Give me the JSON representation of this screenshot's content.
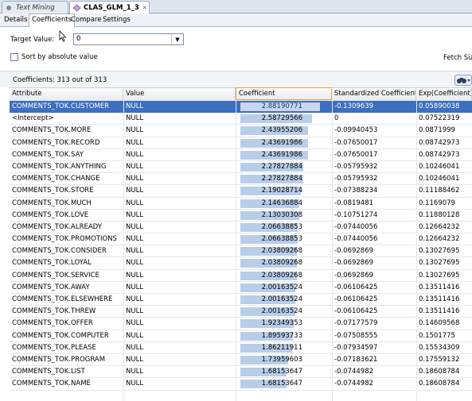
{
  "doc_tabs": [
    {
      "label": "Text Mining",
      "icon": "dot-icon"
    },
    {
      "label": "CLAS_GLM_1_3",
      "icon": "model-icon"
    }
  ],
  "sub_tabs": [
    "Details",
    "Coefficients",
    "Compare",
    "Settings"
  ],
  "target": {
    "label": "Target Value:",
    "value": "0"
  },
  "sort_checkbox": {
    "label": "Sort by absolute value",
    "checked": false
  },
  "fetch_label": "Fetch Siz",
  "coefficients_count": "Coefficients: 313 out of 313",
  "colors": {
    "selected_row": "#3c6fbf",
    "coef_bar": "#b8cde8",
    "sorted_header_border": "#e8a33a"
  },
  "columns": [
    "Attribute",
    "Value",
    "Coefficient",
    "Standardized Coefficient",
    "Exp(Coefficient)"
  ],
  "rows": [
    {
      "attr": "COMMENTS_TOK.CUSTOMER",
      "value": "NULL",
      "coef": "2.88190771",
      "coef_num": 2.88190771,
      "std": "-0.1309639",
      "exp": "0.05890038"
    },
    {
      "attr": "<Intercept>",
      "value": "NULL",
      "coef": "2.58729566",
      "coef_num": 2.58729566,
      "std": "0",
      "exp": "0.07522319"
    },
    {
      "attr": "COMMENTS_TOK.MORE",
      "value": "NULL",
      "coef": "2.43955206",
      "coef_num": 2.43955206,
      "std": "-0.09940453",
      "exp": "0.0871999"
    },
    {
      "attr": "COMMENTS_TOK.RECORD",
      "value": "NULL",
      "coef": "2.43691986",
      "coef_num": 2.43691986,
      "std": "-0.07650017",
      "exp": "0.08742973"
    },
    {
      "attr": "COMMENTS_TOK.SAY",
      "value": "NULL",
      "coef": "2.43691986",
      "coef_num": 2.43691986,
      "std": "-0.07650017",
      "exp": "0.08742973"
    },
    {
      "attr": "COMMENTS_TOK.ANYTHING",
      "value": "NULL",
      "coef": "2.27827884",
      "coef_num": 2.27827884,
      "std": "-0.05795932",
      "exp": "0.10246041"
    },
    {
      "attr": "COMMENTS_TOK.CHANGE",
      "value": "NULL",
      "coef": "2.27827884",
      "coef_num": 2.27827884,
      "std": "-0.05795932",
      "exp": "0.10246041"
    },
    {
      "attr": "COMMENTS_TOK.STORE",
      "value": "NULL",
      "coef": "2.19028714",
      "coef_num": 2.19028714,
      "std": "-0.07388234",
      "exp": "0.11188462"
    },
    {
      "attr": "COMMENTS_TOK.MUCH",
      "value": "NULL",
      "coef": "2.14636884",
      "coef_num": 2.14636884,
      "std": "-0.0819481",
      "exp": "0.1169079"
    },
    {
      "attr": "COMMENTS_TOK.LOVE",
      "value": "NULL",
      "coef": "2.13030308",
      "coef_num": 2.13030308,
      "std": "-0.10751274",
      "exp": "0.11880128"
    },
    {
      "attr": "COMMENTS_TOK.ALREADY",
      "value": "NULL",
      "coef": "2.06638853",
      "coef_num": 2.06638853,
      "std": "-0.07440056",
      "exp": "0.12664232"
    },
    {
      "attr": "COMMENTS_TOK.PROMOTIONS",
      "value": "NULL",
      "coef": "2.06638853",
      "coef_num": 2.06638853,
      "std": "-0.07440056",
      "exp": "0.12664232"
    },
    {
      "attr": "COMMENTS_TOK.CONSIDER",
      "value": "NULL",
      "coef": "2.03809268",
      "coef_num": 2.03809268,
      "std": "-0.0692869",
      "exp": "0.13027695"
    },
    {
      "attr": "COMMENTS_TOK.LOYAL",
      "value": "NULL",
      "coef": "2.03809268",
      "coef_num": 2.03809268,
      "std": "-0.0692869",
      "exp": "0.13027695"
    },
    {
      "attr": "COMMENTS_TOK.SERVICE",
      "value": "NULL",
      "coef": "2.03809268",
      "coef_num": 2.03809268,
      "std": "-0.0692869",
      "exp": "0.13027695"
    },
    {
      "attr": "COMMENTS_TOK.AWAY",
      "value": "NULL",
      "coef": "2.00163524",
      "coef_num": 2.00163524,
      "std": "-0.06106425",
      "exp": "0.13511416"
    },
    {
      "attr": "COMMENTS_TOK.ELSEWHERE",
      "value": "NULL",
      "coef": "2.00163524",
      "coef_num": 2.00163524,
      "std": "-0.06106425",
      "exp": "0.13511416"
    },
    {
      "attr": "COMMENTS_TOK.THREW",
      "value": "NULL",
      "coef": "2.00163524",
      "coef_num": 2.00163524,
      "std": "-0.06106425",
      "exp": "0.13511416"
    },
    {
      "attr": "COMMENTS_TOK.OFFER",
      "value": "NULL",
      "coef": "1.92349353",
      "coef_num": 1.92349353,
      "std": "-0.07177579",
      "exp": "0.14609568"
    },
    {
      "attr": "COMMENTS_TOK.COMPUTER",
      "value": "NULL",
      "coef": "1.89593733",
      "coef_num": 1.89593733,
      "std": "-0.07508555",
      "exp": "0.1501775"
    },
    {
      "attr": "COMMENTS_TOK.PLEASE",
      "value": "NULL",
      "coef": "1.86211911",
      "coef_num": 1.86211911,
      "std": "-0.07934597",
      "exp": "0.15534309"
    },
    {
      "attr": "COMMENTS_TOK.PROGRAM",
      "value": "NULL",
      "coef": "1.73959603",
      "coef_num": 1.73959603,
      "std": "-0.07183621",
      "exp": "0.17559132"
    },
    {
      "attr": "COMMENTS_TOK.LIST",
      "value": "NULL",
      "coef": "1.68153647",
      "coef_num": 1.68153647,
      "std": "-0.0744982",
      "exp": "0.18608784"
    },
    {
      "attr": "COMMENTS_TOK.NAME",
      "value": "NULL",
      "coef": "1.68153647",
      "coef_num": 1.68153647,
      "std": "-0.0744982",
      "exp": "0.18608784"
    }
  ]
}
